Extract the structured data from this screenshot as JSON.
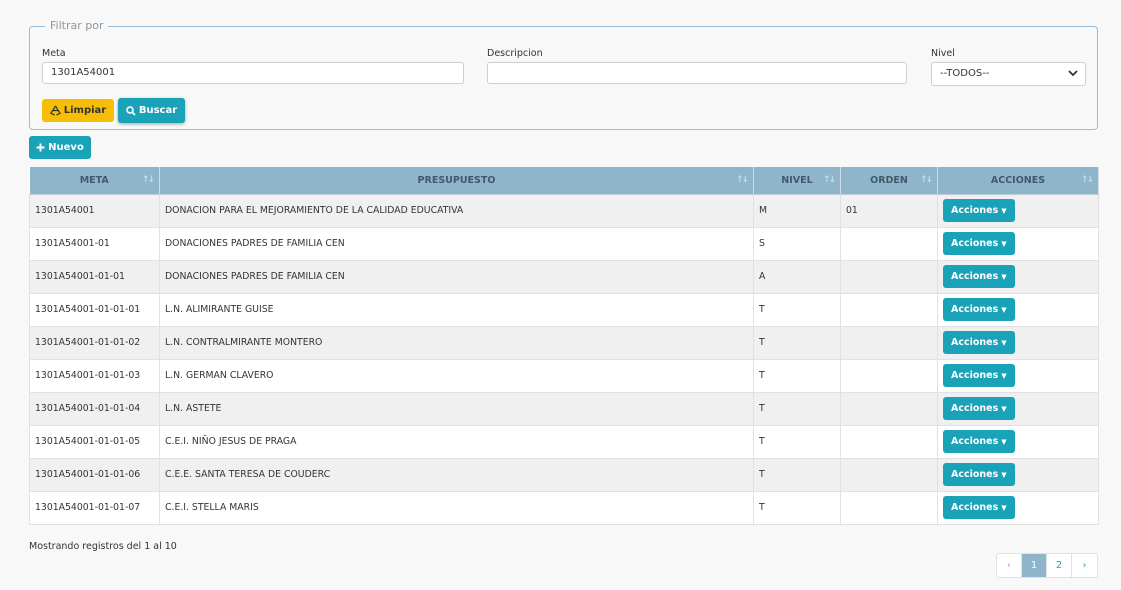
{
  "filter": {
    "legend": "Filtrar por",
    "meta_label": "Meta",
    "meta_value": "1301A54001",
    "descripcion_label": "Descripcion",
    "descripcion_value": "",
    "nivel_label": "Nivel",
    "nivel_selected": "--TODOS--",
    "limpiar_label": "Limpiar",
    "buscar_label": "Buscar"
  },
  "nuevo_label": "Nuevo",
  "table": {
    "columns": [
      "META",
      "PRESUPUESTO",
      "NIVEL",
      "ORDEN",
      "ACCIONES"
    ],
    "action_label": "Acciones",
    "rows": [
      {
        "meta": "1301A54001",
        "presupuesto": "DONACION PARA EL MEJORAMIENTO DE LA CALIDAD EDUCATIVA",
        "nivel": "M",
        "orden": "01"
      },
      {
        "meta": "1301A54001-01",
        "presupuesto": "DONACIONES PADRES DE FAMILIA CEN",
        "nivel": "S",
        "orden": ""
      },
      {
        "meta": "1301A54001-01-01",
        "presupuesto": "DONACIONES PADRES DE FAMILIA CEN",
        "nivel": "A",
        "orden": ""
      },
      {
        "meta": "1301A54001-01-01-01",
        "presupuesto": "L.N. ALIMIRANTE GUISE",
        "nivel": "T",
        "orden": ""
      },
      {
        "meta": "1301A54001-01-01-02",
        "presupuesto": "L.N. CONTRALMIRANTE MONTERO",
        "nivel": "T",
        "orden": ""
      },
      {
        "meta": "1301A54001-01-01-03",
        "presupuesto": "L.N. GERMAN CLAVERO",
        "nivel": "T",
        "orden": ""
      },
      {
        "meta": "1301A54001-01-01-04",
        "presupuesto": "L.N. ASTETE",
        "nivel": "T",
        "orden": ""
      },
      {
        "meta": "1301A54001-01-01-05",
        "presupuesto": "C.E.I. NIÑO JESUS DE PRAGA",
        "nivel": "T",
        "orden": ""
      },
      {
        "meta": "1301A54001-01-01-06",
        "presupuesto": "C.E.E. SANTA TERESA DE COUDERC",
        "nivel": "T",
        "orden": ""
      },
      {
        "meta": "1301A54001-01-01-07",
        "presupuesto": "C.E.I. STELLA MARIS",
        "nivel": "T",
        "orden": ""
      }
    ]
  },
  "info_text": "Mostrando registros del 1 al 10",
  "pagination": {
    "prev": "‹",
    "pages": [
      "1",
      "2"
    ],
    "current": "1",
    "next": "›"
  },
  "colors": {
    "accent": "#1aa2b8",
    "warning": "#f7be07",
    "header": "#8fb5cb"
  }
}
